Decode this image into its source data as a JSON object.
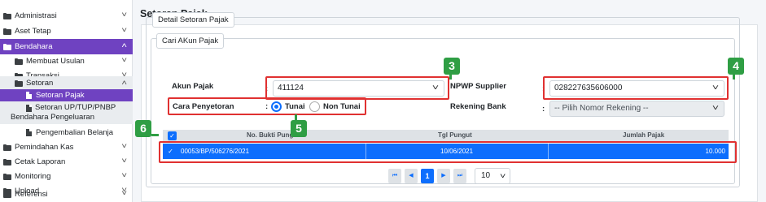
{
  "sidebar": {
    "items": [
      {
        "label": "Administrasi",
        "chevron": "˅"
      },
      {
        "label": "Aset Tetap",
        "chevron": "˅"
      },
      {
        "label": "Bendahara",
        "chevron": "˄"
      },
      {
        "label": "Membuat Usulan",
        "chevron": "˅"
      },
      {
        "label": "Transaksi",
        "chevron": "˅"
      },
      {
        "label": "Setoran",
        "chevron": "˄"
      },
      {
        "label": "Setoran Pajak"
      },
      {
        "label_line1": "Setoran UP/TUP/PNBP",
        "label_line2": "Bendahara Pengeluaran"
      },
      {
        "label": "Pengembalian Belanja"
      },
      {
        "label": "Pemindahan Kas",
        "chevron": "˅"
      },
      {
        "label": "Cetak Laporan",
        "chevron": "˅"
      },
      {
        "label": "Monitoring",
        "chevron": "˅"
      },
      {
        "label": "Upload",
        "chevron": "˅"
      },
      {
        "label": "Referensi",
        "chevron": "˅"
      }
    ]
  },
  "header": {
    "title": "Setoran Pajak"
  },
  "form": {
    "section_title": "Detail Setoran Pajak",
    "subsection_title": "Cari AKun Pajak",
    "akun_pajak": {
      "label": "Akun Pajak",
      "value": "411124"
    },
    "npwp_supplier": {
      "label": "NPWP Supplier",
      "value": "028227635606000"
    },
    "cara_penyetoran": {
      "label": "Cara Penyetoran",
      "options": [
        "Tunai",
        "Non Tunai"
      ],
      "selected": "Tunai"
    },
    "rekening_bank": {
      "label": "Rekening Bank",
      "placeholder": "-- Pilih Nomor Rekening --"
    },
    "colon": ":"
  },
  "table": {
    "headers": [
      "No. Bukti Pungut",
      "Tgl Pungut",
      "Jumlah Pajak"
    ],
    "rows": [
      {
        "no_bukti": "00053/BP/506276/2021",
        "tgl": "10/06/2021",
        "jumlah": "10.000",
        "checked": true
      }
    ]
  },
  "pagination": {
    "first": "⏮",
    "prev": "◀",
    "current": "1",
    "next": "▶",
    "last": "⏭",
    "page_size": "10"
  },
  "annotations": {
    "badges": [
      "3",
      "4",
      "5",
      "6"
    ],
    "color_box": "#e03131",
    "color_badge": "#2f9e44"
  },
  "colors": {
    "accent_purple": "#6f42c1",
    "primary_blue": "#0d6efd"
  }
}
